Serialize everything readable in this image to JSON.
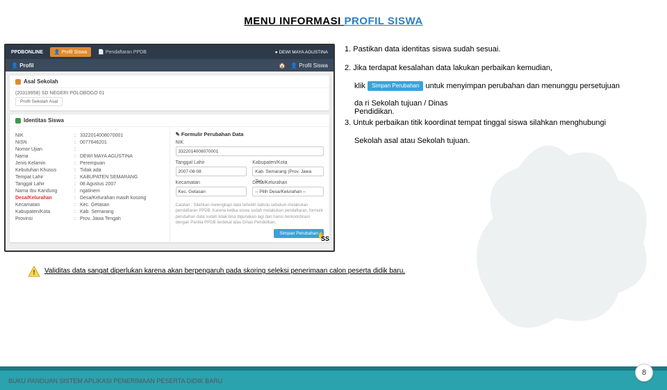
{
  "title": {
    "p1": "MENU INFORMASI ",
    "p2": "PROFIL SISWA"
  },
  "shot": {
    "brand": "PPDBONLINE",
    "tab_profil": "Profil Siswa",
    "tab_pendaftaran": "Pendaftaran PPDB",
    "user": "DEWI MAYA AGUSTINA",
    "profil": "Profil",
    "profil_siswa_link": "Profil Siswa",
    "asal_header": "Asal Sekolah",
    "asal_code": "(20319958) SD NEGERI POLOBOGO 01",
    "pill": "Profil Sekolah Asal",
    "identitas_header": "Identitas Siswa",
    "kv": [
      {
        "k": "NIK",
        "v": "3322014008070001"
      },
      {
        "k": "NISN",
        "v": "0077646201"
      },
      {
        "k": "Nomor Ujian",
        "v": ""
      },
      {
        "k": "Nama",
        "v": "DEWI MAYA AGUSTINA"
      },
      {
        "k": "Jenis Kelamin",
        "v": "Perempuan"
      },
      {
        "k": "Kebutuhan Khusus",
        "v": "Tidak ada"
      },
      {
        "k": "Tempat Lahir",
        "v": "KABUPATEN SEMARANG"
      },
      {
        "k": "Tanggal Lahir",
        "v": "08 Agustus 2007"
      },
      {
        "k": "Nama Ibu Kandung",
        "v": "ngatinem"
      },
      {
        "k": "Desa/Kelurahan",
        "v": "Desa/Kelurahan masih kosong",
        "red": true
      },
      {
        "k": "Kecamatan",
        "v": "Kec. Getasan"
      },
      {
        "k": "Kabupaten/Kota",
        "v": "Kab. Semarang"
      },
      {
        "k": "Provinsi",
        "v": "Prov. Jawa Tengah"
      }
    ],
    "form_header": "Formulir Perubahan Data",
    "nik_label": "NIK",
    "nik_val": "3322014008070001",
    "tl_label": "Tanggal Lahir",
    "tl_val": "2007-08-08",
    "kab_label": "Kabupaten/Kota",
    "kab_val": "Kab. Semarang (Prov. Jawa Ten…",
    "kec_label": "Kecamatan",
    "kec_val": "Kec. Getasan",
    "desa_label": "Desa/Kelurahan",
    "desa_val": "-- Pilih Desa/Kelurahan --",
    "catatan": "Catatan : Silahkan melengkapi data terlebih dahulu sebelum melakukan pendaftaran PPDB. Karena ketika siswa sudah melakukan pendaftaran, formulir perubahan data sudah tidak bisa digunakan lagi dan harus berkoordinasi dengan Panitia PPDB terdekat atau Dinas Pendidikan.",
    "simpan": "Simpan Perubahan",
    "ss": "SS"
  },
  "inst": {
    "l1": "1. Pastikan data identitas siswa sudah sesuai.",
    "l2": "2. Jika terdapat kesalahan data lakukan perbaikan kemudian,",
    "l2b_pre": "klik ",
    "btn": "Simpan Perubahan",
    "l2b_post": " untuk menyimpan perubahan dan menunggu persetujuan",
    "l2c": "da ri Sekolah tujuan / Dinas",
    "l2d": "Pendidikan.",
    "l3": "3. Untuk perbaikan titik koordinat tempat tinggal siswa silahkan menghubungi",
    "l3b": "Sekolah asal atau Sekolah tujuan."
  },
  "warn": "Validitas data sangat diperlukan karena akan berpengaruh pada skoring seleksi penerimaan calon peserta didik baru.",
  "footer": "BUKU PANDUAN SISTEM APLIKASI PENERIMAAN PESERTA DIDIK BARU",
  "page": "8"
}
